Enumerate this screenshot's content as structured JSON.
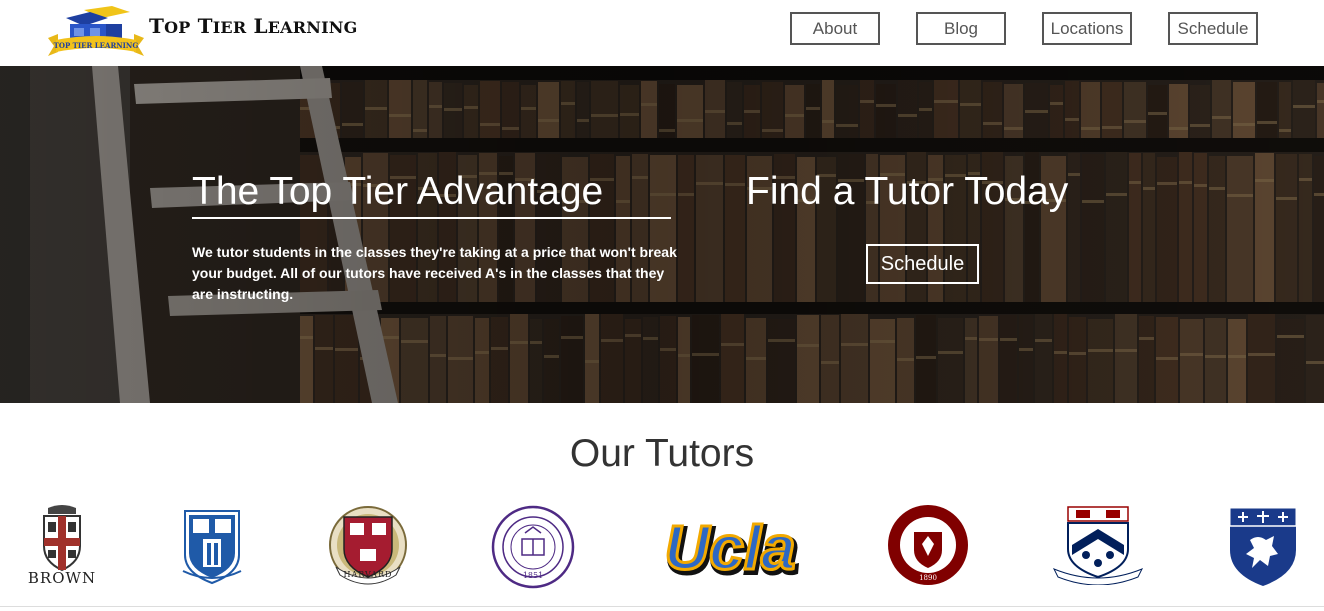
{
  "header": {
    "brand_first": "T",
    "brand_word1": "OP",
    "brand_second": "T",
    "brand_word2": "IER",
    "brand_third": "L",
    "brand_word3": "EARNING",
    "logo_text": "TOP TIER LEARNING",
    "nav": {
      "about": "About",
      "blog": "Blog",
      "locations": "Locations",
      "schedule": "Schedule"
    }
  },
  "hero": {
    "title": "The Top Tier Advantage",
    "description": "We tutor students in the classes they're taking at a price that won't break your budget. All of our tutors have received A's in the classes that they are instructing.",
    "cta_title": "Find a Tutor Today",
    "cta_button": "Schedule"
  },
  "tutors": {
    "title": "Our Tutors",
    "universities": {
      "brown": "BROWN",
      "harvard": "HARVARD",
      "northwestern_year": "1851",
      "ucla": "Ucla",
      "chicago_year": "1890"
    }
  },
  "colors": {
    "nav_border": "#555555",
    "harvard_red": "#a51c30",
    "duke_blue": "#1f5aa8",
    "northwestern_purple": "#4e2a84",
    "ucla_gold": "#f2a900",
    "ucla_blue": "#2d68c4",
    "chicago_maroon": "#800000",
    "penn_blue": "#011f5b",
    "penn_red": "#990000",
    "yale_blue": "#1a3a8a"
  }
}
